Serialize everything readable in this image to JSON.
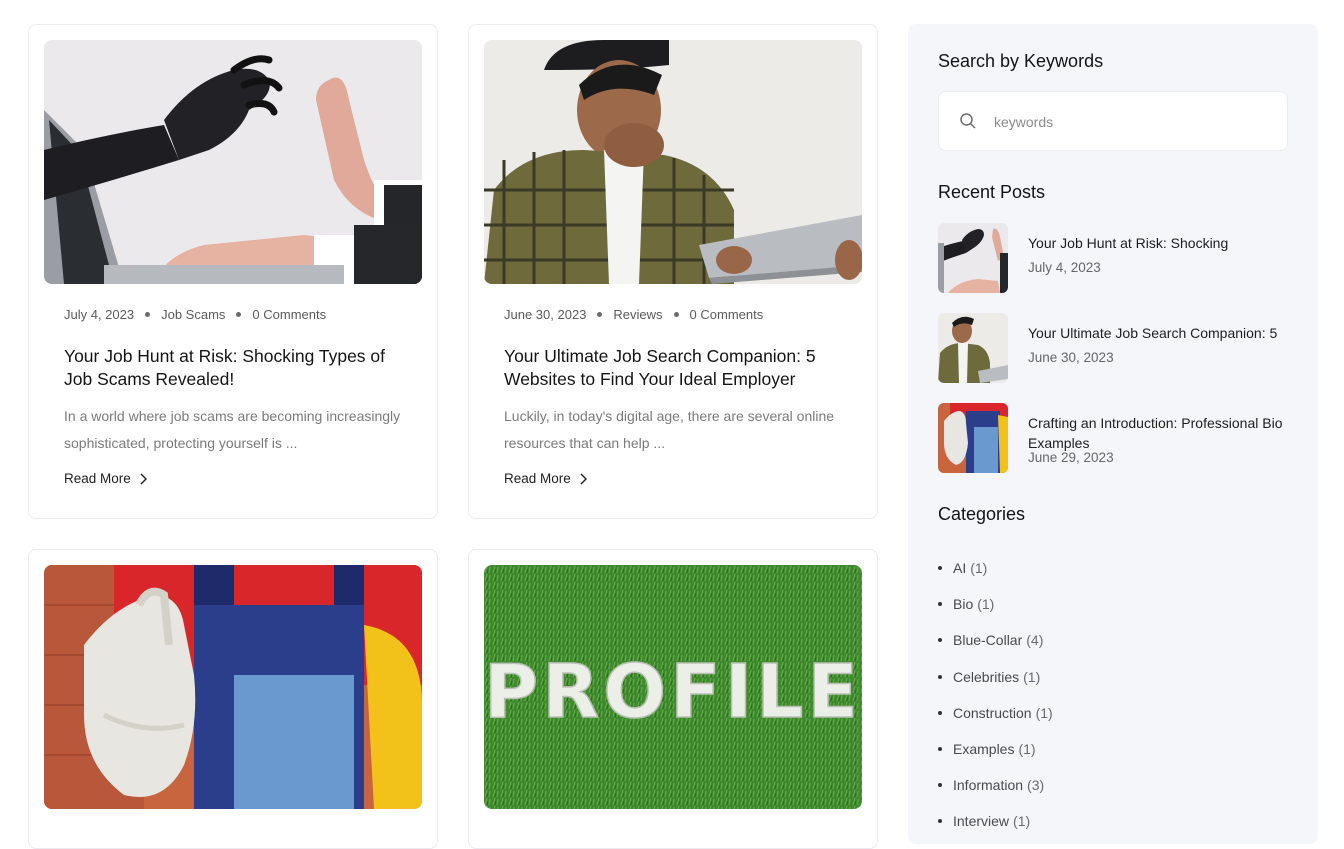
{
  "posts": [
    {
      "date": "July 4, 2023",
      "category": "Job Scams",
      "comments": "0 Comments",
      "title": "Your Job Hunt at Risk: Shocking Types of Job Scams Revealed!",
      "excerpt": "In a world where job scams are becoming increasingly sophisticated, protecting yourself is ...",
      "read_more": "Read More"
    },
    {
      "date": "June 30, 2023",
      "category": "Reviews",
      "comments": "0 Comments",
      "title": "Your Ultimate Job Search Companion: 5 Websites to Find Your Ideal Employer",
      "excerpt": "Luckily, in today's digital age, there are several online resources that can help ...",
      "read_more": "Read More"
    },
    {
      "image_text": "PROFILE"
    }
  ],
  "sidebar": {
    "search_heading": "Search by Keywords",
    "search_placeholder": "keywords",
    "recent_heading": "Recent Posts",
    "recent": [
      {
        "title": "Your Job Hunt at Risk: Shocking",
        "date": "July 4, 2023"
      },
      {
        "title": "Your Ultimate Job Search Companion: 5",
        "date": "June 30, 2023"
      },
      {
        "title": "Crafting an Introduction: Professional Bio Examples",
        "date": "June 29, 2023"
      }
    ],
    "categories_heading": "Categories",
    "categories": [
      {
        "name": "AI",
        "count": "(1)"
      },
      {
        "name": "Bio",
        "count": "(1)"
      },
      {
        "name": "Blue-Collar",
        "count": "(4)"
      },
      {
        "name": "Celebrities",
        "count": "(1)"
      },
      {
        "name": "Construction",
        "count": "(1)"
      },
      {
        "name": "Examples",
        "count": "(1)"
      },
      {
        "name": "Information",
        "count": "(3)"
      },
      {
        "name": "Interview",
        "count": "(1)"
      }
    ]
  }
}
